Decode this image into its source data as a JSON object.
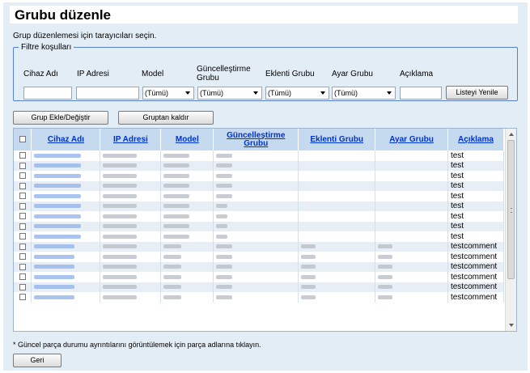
{
  "page": {
    "title": "Grubu düzenle",
    "intro": "Grup düzenlemesi için tarayıcıları seçin."
  },
  "filter": {
    "legend": "Filtre koşulları",
    "labels": {
      "device_name": "Cihaz Adı",
      "ip_address": "IP Adresi",
      "model": "Model",
      "update_group": "Güncelleştirme Grubu",
      "addon_group": "Eklenti Grubu",
      "settings_group": "Ayar Grubu",
      "description": "Açıklama"
    },
    "values": {
      "device_name": "",
      "ip_address": "",
      "model": "(Tümü)",
      "update_group": "(Tümü)",
      "addon_group": "(Tümü)",
      "settings_group": "(Tümü)",
      "description": ""
    },
    "refresh_label": "Listeyi Yenile"
  },
  "actions": {
    "add_change_label": "Grup Ekle/Değiştir",
    "remove_label": "Gruptan kaldır"
  },
  "table": {
    "columns": [
      "Cihaz Adı",
      "IP Adresi",
      "Model",
      "Güncelleştirme Grubu",
      "Eklenti Grubu",
      "Ayar Grubu",
      "Açıklama"
    ],
    "rows": [
      {
        "description": "test"
      },
      {
        "description": "test"
      },
      {
        "description": "test"
      },
      {
        "description": "test"
      },
      {
        "description": "test"
      },
      {
        "description": "test"
      },
      {
        "description": "test"
      },
      {
        "description": "test"
      },
      {
        "description": "test"
      },
      {
        "description": "testcomment"
      },
      {
        "description": "testcomment"
      },
      {
        "description": "testcomment"
      },
      {
        "description": "testcomment"
      },
      {
        "description": "testcomment"
      },
      {
        "description": "testcomment"
      }
    ]
  },
  "footer": {
    "note": "* Güncel parça durumu ayrıntılarını görüntülemek için parça adlarına tıklayın.",
    "back_label": "Geri"
  },
  "colors": {
    "page_background": "#e3edf6",
    "header_background": "#c5d9ef",
    "link": "#0033cc",
    "fieldset_border": "#5a7fd0"
  },
  "icons": [
    "checkbox-icon",
    "dropdown-caret-icon",
    "scroll-up-icon",
    "scroll-down-icon"
  ]
}
